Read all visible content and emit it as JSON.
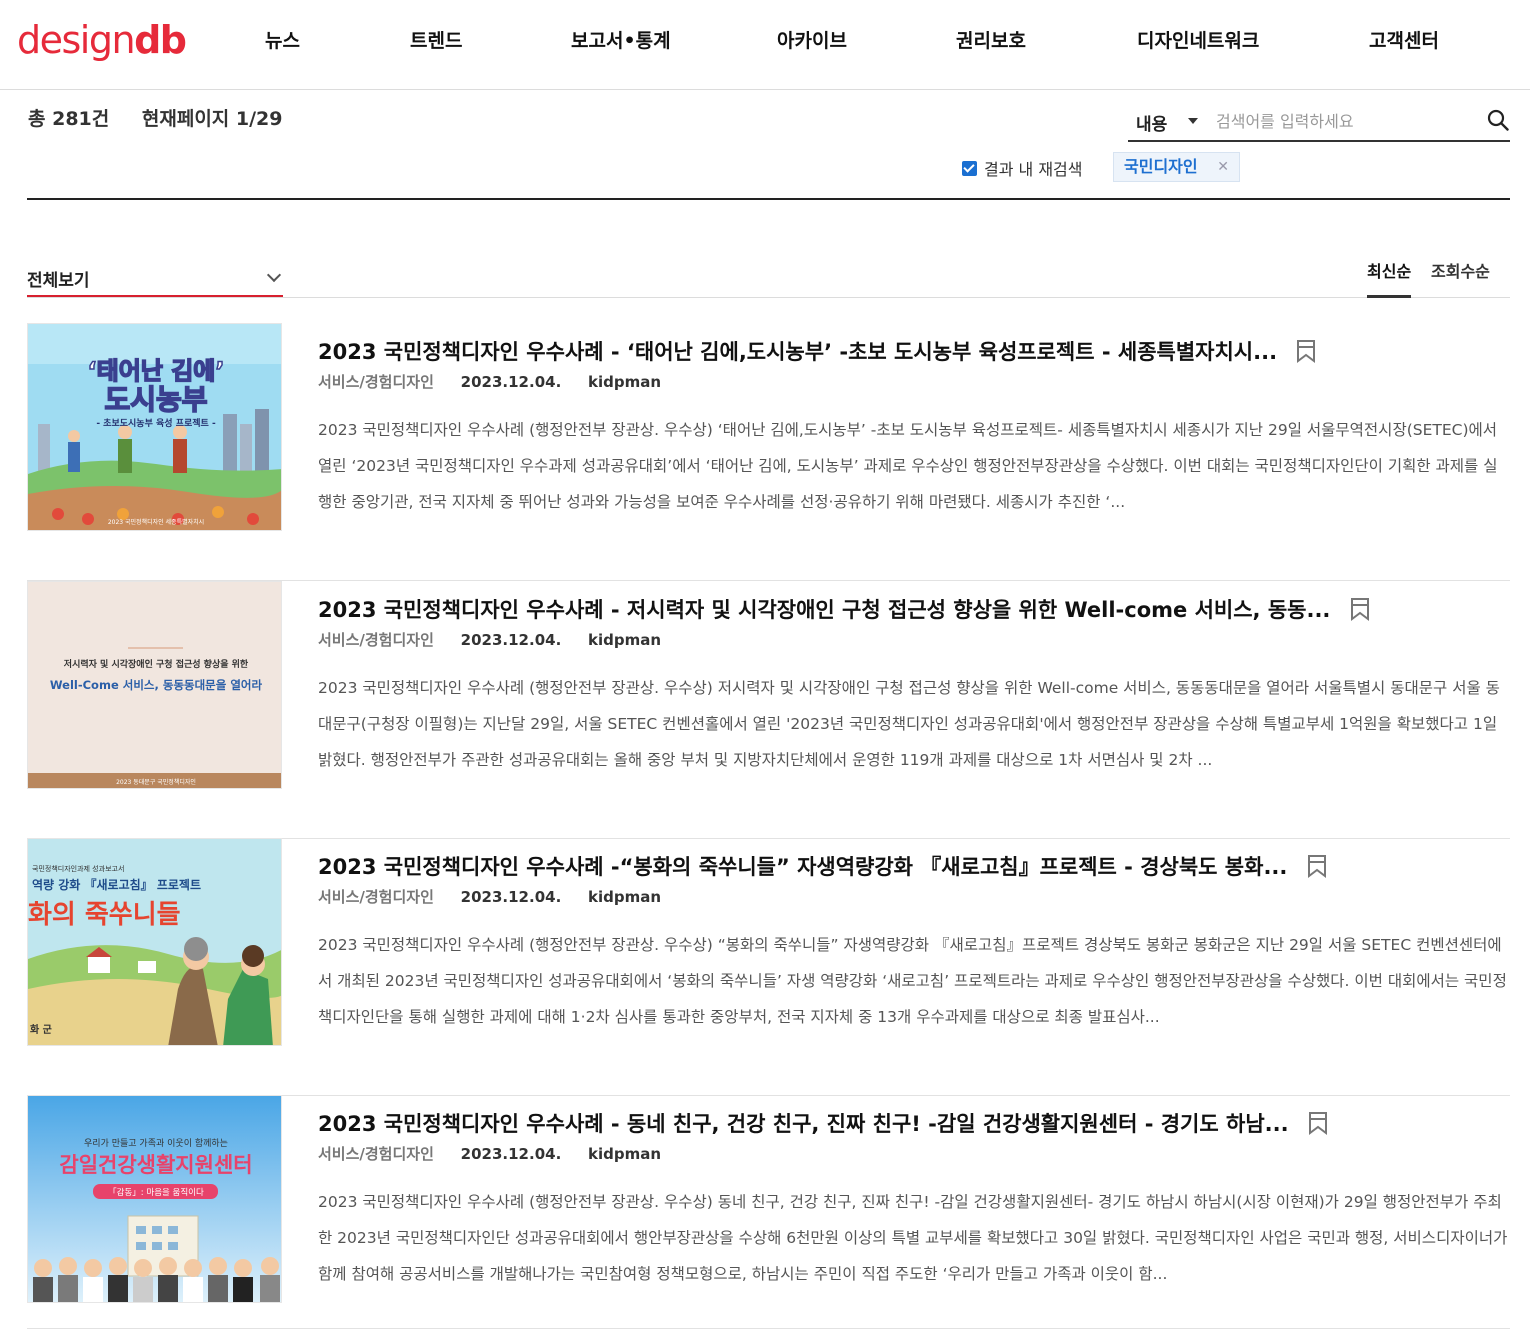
{
  "header": {
    "logo_part1": "design",
    "logo_part2": "db",
    "nav": [
      "뉴스",
      "트렌드",
      "보고서•통계",
      "아카이브",
      "권리보호",
      "디자인네트워크",
      "고객센터"
    ]
  },
  "summary": {
    "total": "총 281건",
    "page": "현재페이지 1/29"
  },
  "search": {
    "scope": "내용",
    "placeholder": "검색어를 입력하세요",
    "refine_label": "결과 내 재검색",
    "tag": "국민디자인"
  },
  "filter": {
    "label": "전체보기",
    "sort": [
      "최신순",
      "조회수순"
    ]
  },
  "colors": {
    "brand": "#e62a3a",
    "tag_text": "#1e6fd0",
    "filter_underline": "#d7202f"
  },
  "articles": [
    {
      "title": "2023 국민정책디자인 우수사례 - ‘태어난 김에,도시농부’ -초보 도시농부 육성프로젝트 - 세종특별자치시...",
      "category": "서비스/경험디자인",
      "date": "2023.12.04.",
      "author": "kidpman",
      "body": "2023 국민정책디자인 우수사례 (행정안전부 장관상. 우수상) ‘태어난 김에,도시농부’ -초보 도시농부 육성프로젝트- 세종특별자치시   세종시가 지난 29일 서울무역전시장(SETEC)에서 열린 ‘2023년 국민정책디자인 우수과제 성과공유대회’에서 ‘태어난 김에, 도시농부’ 과제로 우수상인 행정안전부장관상을 수상했다. 이번 대회는 국민정책디자인단이 기획한 과제를 실행한 중앙기관, 전국 지자체 중 뛰어난 성과와 가능성을 보여준 우수사례를 선정·공유하기 위해 마련됐다. 세종시가 추진한 ‘...",
      "thumb_text1": "‘태어난 김에’",
      "thumb_text2": "도시농부",
      "thumb_text3": "- 초보도시농부 육성 프로젝트 -",
      "thumb_text4": "2023 국민정책디자인   세종특별자치시"
    },
    {
      "title": "2023 국민정책디자인 우수사례 - 저시력자 및 시각장애인 구청 접근성 향상을 위한 Well-come 서비스, 동동...",
      "category": "서비스/경험디자인",
      "date": "2023.12.04.",
      "author": "kidpman",
      "body": "2023 국민정책디자인 우수사례 (행정안전부 장관상. 우수상) 저시력자 및 시각장애인 구청 접근성 향상을 위한 Well-come 서비스, 동동동대문을 열어라 서울특별시 동대문구   서울 동대문구(구청장 이필형)는 지난달 29일, 서울 SETEC 컨벤션홀에서 열린 '2023년 국민정책디자인 성과공유대회'에서 행정안전부 장관상을 수상해 특별교부세 1억원을 확보했다고 1일 밝혔다. 행정안전부가 주관한 성과공유대회는 올해 중앙 부처 및 지방자치단체에서 운영한 119개 과제를 대상으로 1차 서면심사 및 2차 ...",
      "thumb_text1": "저시력자 및 시각장애인 구청 접근성 향상을 위한",
      "thumb_text2": "Well-Come 서비스, 동동동대문을 열어라",
      "thumb_text3": "2023 동대문구 국민정책디자인"
    },
    {
      "title": "2023 국민정책디자인 우수사례 -“봉화의 죽쑤니들” 자생역량강화 『새로고침』프로젝트 - 경상북도 봉화...",
      "category": "서비스/경험디자인",
      "date": "2023.12.04.",
      "author": "kidpman",
      "body": "2023 국민정책디자인 우수사례 (행정안전부 장관상. 우수상) “봉화의 죽쑤니들” 자생역량강화 『새로고침』프로젝트 경상북도 봉화군   봉화군은 지난 29일 서울 SETEC 컨벤션센터에서 개최된 2023년 국민정책디자인 성과공유대회에서 ‘봉화의 죽쑤니들’ 자생 역량강화 ‘새로고침’ 프로젝트라는 과제로 우수상인 행정안전부장관상을 수상했다. 이번 대회에서는 국민정책디자인단을 통해 실행한 과제에 대해 1·2차 심사를 통과한 중앙부처, 전국 지자체 중 13개 우수과제를 대상으로 최종 발표심사...",
      "thumb_text1": "국민정책디자인과제 성과보고서",
      "thumb_text2": "역량 강화 『새로고침』 프로젝트",
      "thumb_text3": "화의 죽쑤니들",
      "thumb_text4": "화 군"
    },
    {
      "title": "2023 국민정책디자인 우수사례 - 동네 친구, 건강 친구, 진짜 친구! -감일 건강생활지원센터 - 경기도 하남...",
      "category": "서비스/경험디자인",
      "date": "2023.12.04.",
      "author": "kidpman",
      "body": "2023 국민정책디자인 우수사례 (행정안전부 장관상. 우수상) 동네 친구, 건강 친구, 진짜 친구! -감일 건강생활지원센터- 경기도 하남시   하남시(시장 이현재)가 29일 행정안전부가 주최한 2023년 국민정책디자인단 성과공유대회에서 행안부장관상을 수상해 6천만원 이상의 특별 교부세를 확보했다고 30일 밝혔다. 국민정책디자인 사업은 국민과 행정, 서비스디자이너가 함께 참여해 공공서비스를 개발해나가는 국민참여형 정책모형으로, 하남시는 주민이 직접 주도한 ‘우리가 만들고 가족과 이웃이 함...",
      "thumb_text1": "우리가 만들고 가족과 이웃이 함께하는",
      "thumb_text2": "감일건강생활지원센터",
      "thumb_text3": "「감동」: 마음을 움직이다"
    }
  ]
}
